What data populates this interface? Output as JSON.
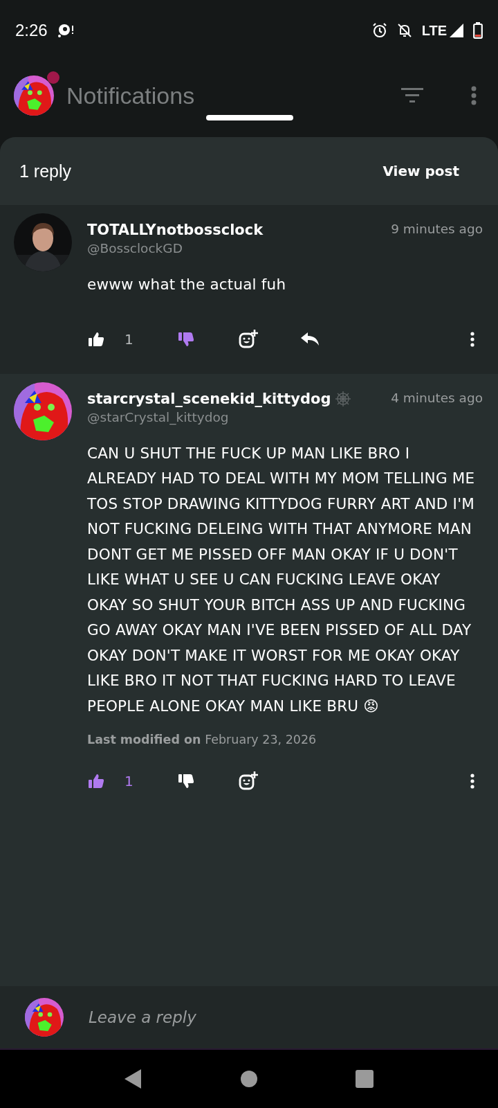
{
  "status_bar": {
    "time": "2:26",
    "network": "LTE"
  },
  "app_bar": {
    "title": "Notifications"
  },
  "sheet": {
    "title": "1 reply",
    "action": "View post"
  },
  "comments": [
    {
      "name": "TOTALLYnotbossclock",
      "handle": "@BossclockGD",
      "time": "9 minutes ago",
      "flair": false,
      "body": "ewww what the actual fuh",
      "likes": "1",
      "liked": false,
      "disliked": true,
      "can_reply": true
    },
    {
      "name": "starcrystal_scenekid_kittydog",
      "handle": "@starCrystal_kittydog",
      "time": "4 minutes ago",
      "flair": true,
      "body": "CAN U SHUT THE FUCK UP MAN LIKE BRO I ALREADY HAD TO DEAL WITH MY MOM TELLING ME TOS STOP DRAWING KITTYDOG FURRY ART AND I'M NOT FUCKING DELEING WITH THAT ANYMORE MAN DONT GET ME PISSED OFF MAN OKAY IF U DON'T LIKE WHAT U SEE U CAN FUCKING LEAVE OKAY OKAY SO SHUT YOUR BITCH ASS UP AND FUCKING GO AWAY OKAY MAN I'VE BEEN PISSED OF ALL DAY OKAY DON'T MAKE IT WORST FOR ME OKAY OKAY LIKE BRO IT NOT THAT FUCKING HARD TO LEAVE PEOPLE ALONE OKAY MAN LIKE BRU 😡",
      "modified_label": "Last modified on",
      "modified_date": "February 23, 2026",
      "likes": "1",
      "liked": true,
      "disliked": false,
      "can_reply": false
    }
  ],
  "reply_bar": {
    "placeholder": "Leave a reply"
  }
}
